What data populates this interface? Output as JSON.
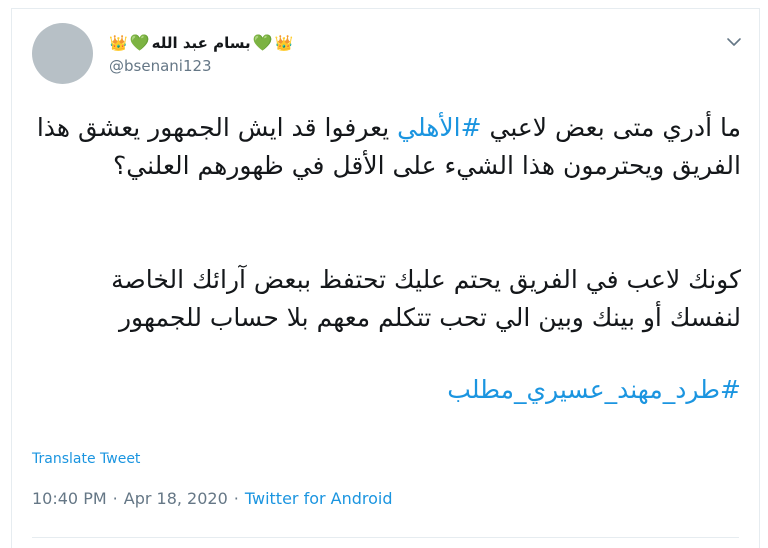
{
  "tweet": {
    "display_name": "بسام عبد الله",
    "handle": "@bsenani123",
    "line1_before": "ما أدري متى بعض لاعبي ",
    "line1_hashtag": "#الأهلي",
    "line1_after": " يعرفوا قد ايش الجمهور يعشق هذا الفريق ويحترمون هذا الشيء على الأقل في ظهورهم العلني؟",
    "paragraph2": "كونك لاعب في الفريق يحتم عليك تحتفظ ببعض آرائك الخاصة لنفسك أو بينك وبين الي تحب تتكلم معهم بلا حساب للجمهور",
    "hashtag2": "#طرد_مهند_عسيري_مطلب",
    "translate_label": "Translate Tweet",
    "time": "10:40 PM",
    "separator": "·",
    "date": "Apr 18, 2020",
    "source": "Twitter for Android"
  },
  "icons": {
    "crown": "crown-icon",
    "heart": "green-heart-icon",
    "caret": "chevron-down-icon"
  },
  "colors": {
    "link": "#1b95e0",
    "secondary_text": "#657786",
    "heart": "#58a23a",
    "crown": "#e8b200"
  }
}
